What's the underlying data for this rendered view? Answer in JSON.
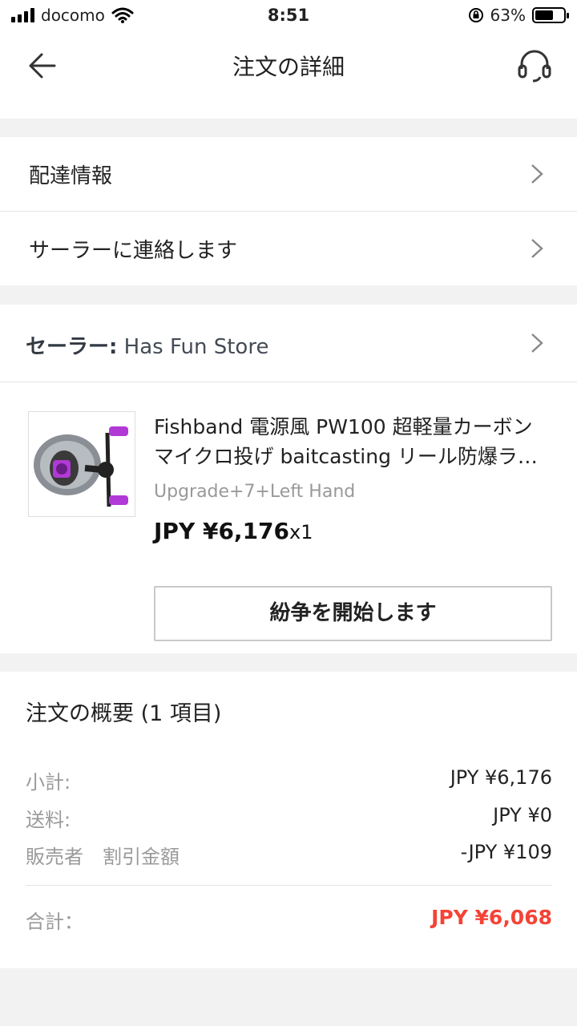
{
  "status_bar": {
    "carrier": "docomo",
    "time": "8:51",
    "battery": "63%",
    "battery_level": 0.63
  },
  "header": {
    "title": "注文の詳細",
    "back_icon": "arrow-left-icon",
    "support_icon": "headset-icon"
  },
  "menu": {
    "delivery_label": "配達情報",
    "contact_label": "サーラーに連絡します"
  },
  "seller": {
    "prefix": "セーラー:",
    "name": " Has Fun Store"
  },
  "product": {
    "name_line1": "Fishband 電源風 PW100 超軽量カーボン",
    "name_line2": "マイクロ投げ baitcasting リール防爆ラ…",
    "variant": "Upgrade+7+Left Hand",
    "price": "JPY ¥6,176",
    "qty": "x1",
    "dispute_label": "紛争を開始します"
  },
  "summary": {
    "title": "注文の概要 (1 項目)",
    "subtotal_label": "小計:",
    "subtotal_value": "JPY ¥6,176",
    "shipping_label": "送料:",
    "shipping_value": "JPY ¥0",
    "discount_label": "販売者　割引金額",
    "discount_value": "-JPY ¥109",
    "total_label": "合計：",
    "total_value": "JPY ¥6,068"
  },
  "colors": {
    "accent_red": "#f44336",
    "reel_purple": "#b13ad6"
  }
}
